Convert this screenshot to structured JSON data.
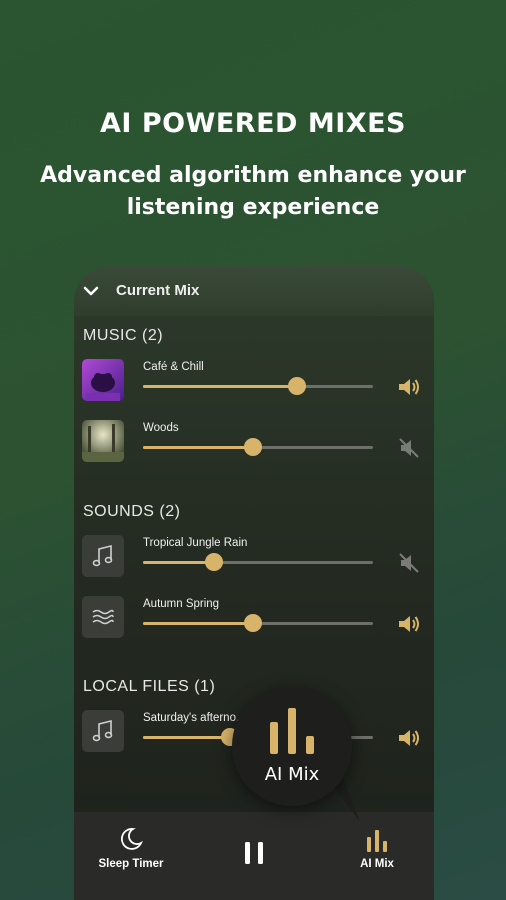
{
  "promo": {
    "headline": "AI POWERED MIXES",
    "subline": "Advanced algorithm enhance your listening experience"
  },
  "panel": {
    "title": "Current Mix",
    "sections": [
      {
        "title": "MUSIC (2)",
        "tracks": [
          {
            "name": "Café & Chill",
            "volume": 0.67,
            "muted": false,
            "thumb": "purple-cafe-art"
          },
          {
            "name": "Woods",
            "volume": 0.48,
            "muted": true,
            "thumb": "forest-art"
          }
        ]
      },
      {
        "title": "SOUNDS (2)",
        "tracks": [
          {
            "name": "Tropical Jungle Rain",
            "volume": 0.31,
            "muted": true,
            "thumb": "music-note-icon"
          },
          {
            "name": "Autumn Spring",
            "volume": 0.48,
            "muted": false,
            "thumb": "waves-icon"
          }
        ]
      },
      {
        "title": "LOCAL FILES (1)",
        "tracks": [
          {
            "name": "Saturday's afterno…",
            "volume": 0.38,
            "muted": false,
            "thumb": "music-note-icon"
          }
        ]
      }
    ]
  },
  "fab": {
    "label": "AI Mix",
    "icon": "bars-icon"
  },
  "nav": {
    "sleep_label": "Sleep Timer",
    "play_state": "pause-icon",
    "mix_label": "AI Mix"
  },
  "colors": {
    "accent": "#d8b46a",
    "muted_icon": "#7a7a78",
    "panel": "#252c22"
  }
}
